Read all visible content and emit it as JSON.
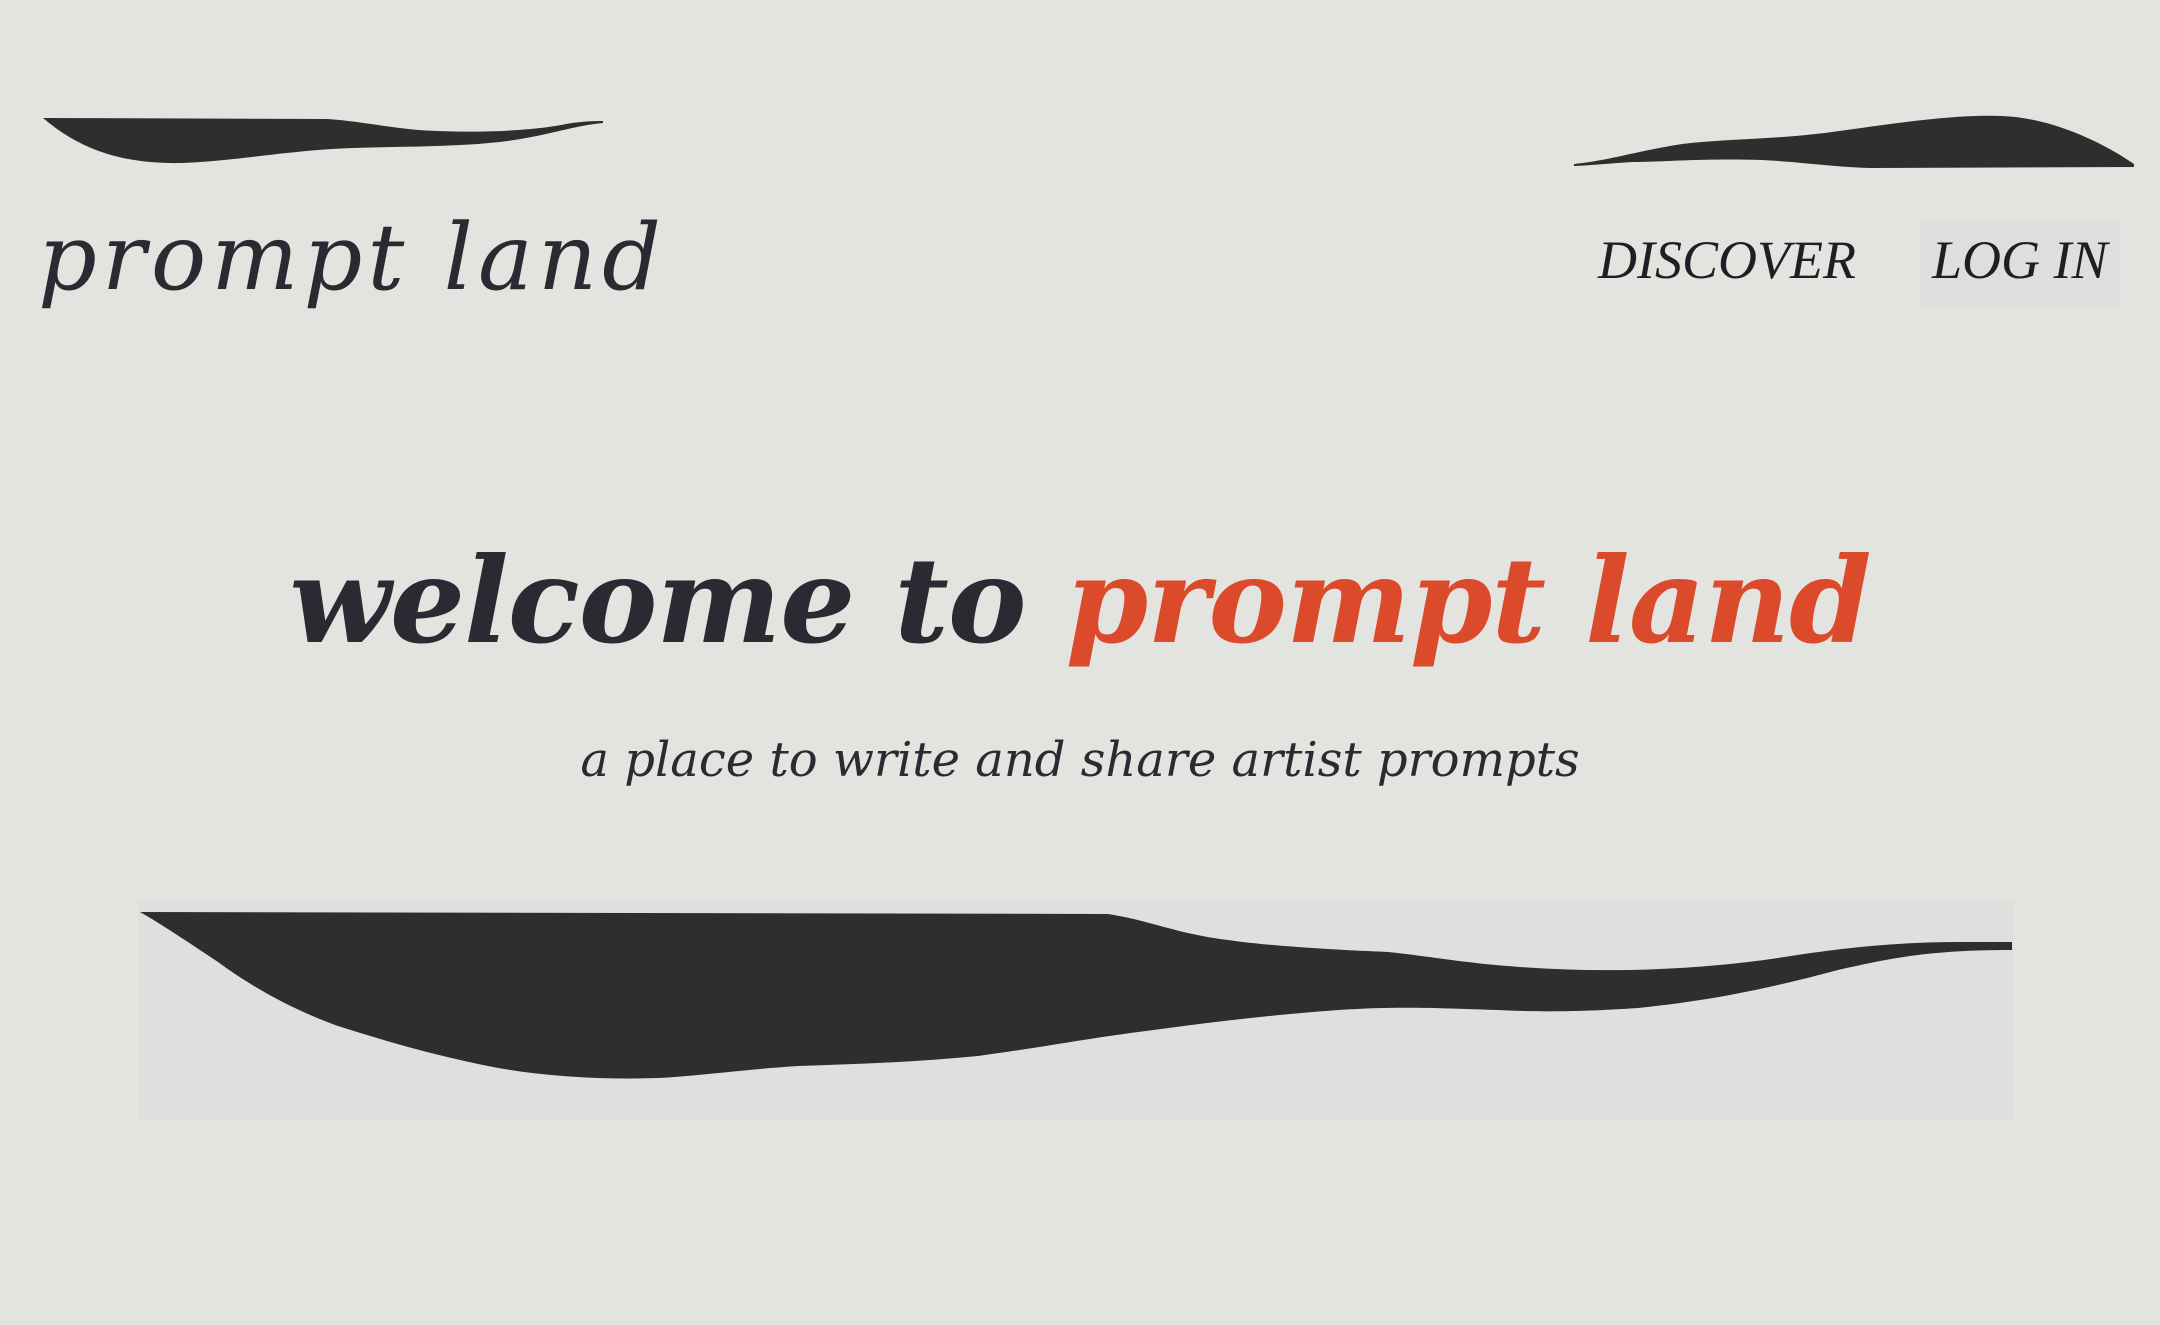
{
  "header": {
    "logo_text": "prompt land"
  },
  "nav": {
    "items": [
      {
        "label": "DISCOVER"
      },
      {
        "label": "LOG IN"
      }
    ]
  },
  "hero": {
    "title_lead": "welcome to ",
    "title_accent": "prompt land",
    "subtitle": "a place to write and share artist prompts"
  },
  "colors": {
    "background": "#e3e3df",
    "text": "#2b2a33",
    "accent": "#db4a2b",
    "brush": "#2e2e2e"
  },
  "icons": {
    "logo_stroke": "brush-stroke-icon",
    "nav_stroke": "brush-stroke-icon",
    "hero_stroke": "brush-stroke-icon"
  }
}
